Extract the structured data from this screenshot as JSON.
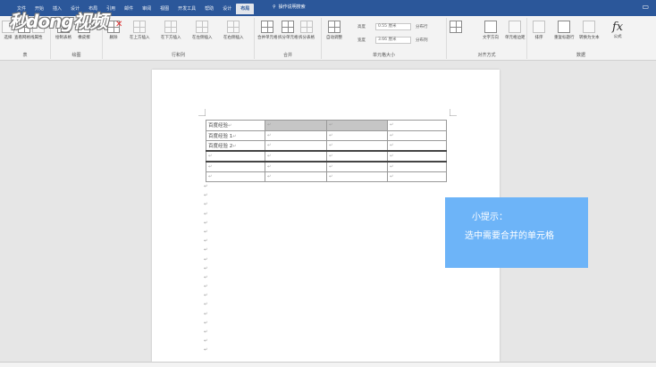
{
  "logo": "秒dong视频",
  "tabs": [
    "文件",
    "开始",
    "插入",
    "设计",
    "布局",
    "引用",
    "邮件",
    "审阅",
    "视图",
    "开发工具",
    "帮助",
    "设计",
    "布局"
  ],
  "active_tab_index": 12,
  "tell_me": "操作说明搜索",
  "ribbon": {
    "groups": [
      "表",
      "绘图",
      "行和列",
      "合并",
      "单元格大小",
      "对齐方式",
      "数据"
    ],
    "buttons": {
      "select": "选择",
      "view_gridlines": "查看网格线",
      "properties": "属性",
      "draw_table": "绘制表格",
      "eraser": "橡皮擦",
      "delete": "删除",
      "insert_above": "在上方插入",
      "insert_below": "在下方插入",
      "insert_left": "在左侧插入",
      "insert_right": "在右侧插入",
      "merge_cells": "合并单元格",
      "split_cells": "拆分单元格",
      "split_table": "拆分表格",
      "autofit": "自动调整",
      "height_label": "高度",
      "height_value": "0.55 厘米",
      "width_label": "宽度",
      "width_value": "3.66 厘米",
      "distribute_rows": "分布行",
      "distribute_cols": "分布列",
      "text_direction": "文字方向",
      "cell_margins": "单元格边距",
      "sort": "排序",
      "repeat_header": "重复标题行",
      "convert_to_text": "转换为文本",
      "formula": "公式",
      "formula_symbol": "fx"
    }
  },
  "document": {
    "table_rows": [
      [
        "百度经验",
        "",
        "",
        ""
      ],
      [
        "百度经验 1",
        "",
        "",
        ""
      ],
      [
        "百度经验 2",
        "",
        "",
        ""
      ],
      [
        "",
        "",
        "",
        ""
      ],
      [
        "",
        "",
        "",
        ""
      ],
      [
        "",
        "",
        "",
        ""
      ]
    ],
    "mark": "↵",
    "pilcrow": "↵"
  },
  "tip": {
    "title": "小提示：",
    "body": "选中需要合并的单元格"
  }
}
